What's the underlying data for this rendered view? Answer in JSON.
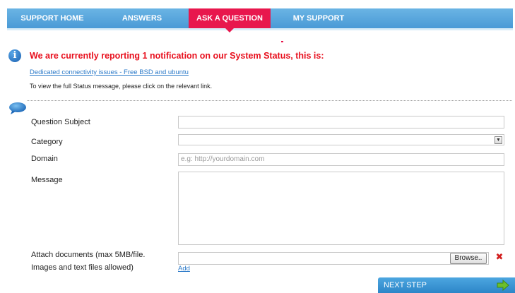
{
  "nav": {
    "items": [
      {
        "label": "SUPPORT HOME",
        "active": false
      },
      {
        "label": "ANSWERS",
        "active": false
      },
      {
        "label": "ASK A QUESTION",
        "active": true
      },
      {
        "label": "MY SUPPORT",
        "active": false
      }
    ]
  },
  "notification": {
    "icon": "info-icon",
    "title": "We are currently reporting 1 notification on our System Status, this is:",
    "link": "Dedicated connectivity issues - Free BSD and ubuntu",
    "text": "To view the full Status message, please click on the relevant link."
  },
  "form": {
    "subject_label": "Question Subject",
    "subject_value": "",
    "category_label": "Category",
    "category_value": "",
    "domain_label": "Domain",
    "domain_placeholder": "e.g: http://yourdomain.com",
    "message_label": "Message",
    "attach_label_line1": "Attach documents (max 5MB/file.",
    "attach_label_line2": "Images and text files allowed)",
    "browse_label": "Browse..",
    "add_label": "Add"
  },
  "next_button": {
    "label": "NEXT STEP"
  },
  "colors": {
    "nav_blue": "#4a9ad6",
    "active_tab": "#e8174d",
    "notice_red": "#e8101e",
    "link_blue": "#2a79c8",
    "next_arrow": "#6cbf2c"
  }
}
